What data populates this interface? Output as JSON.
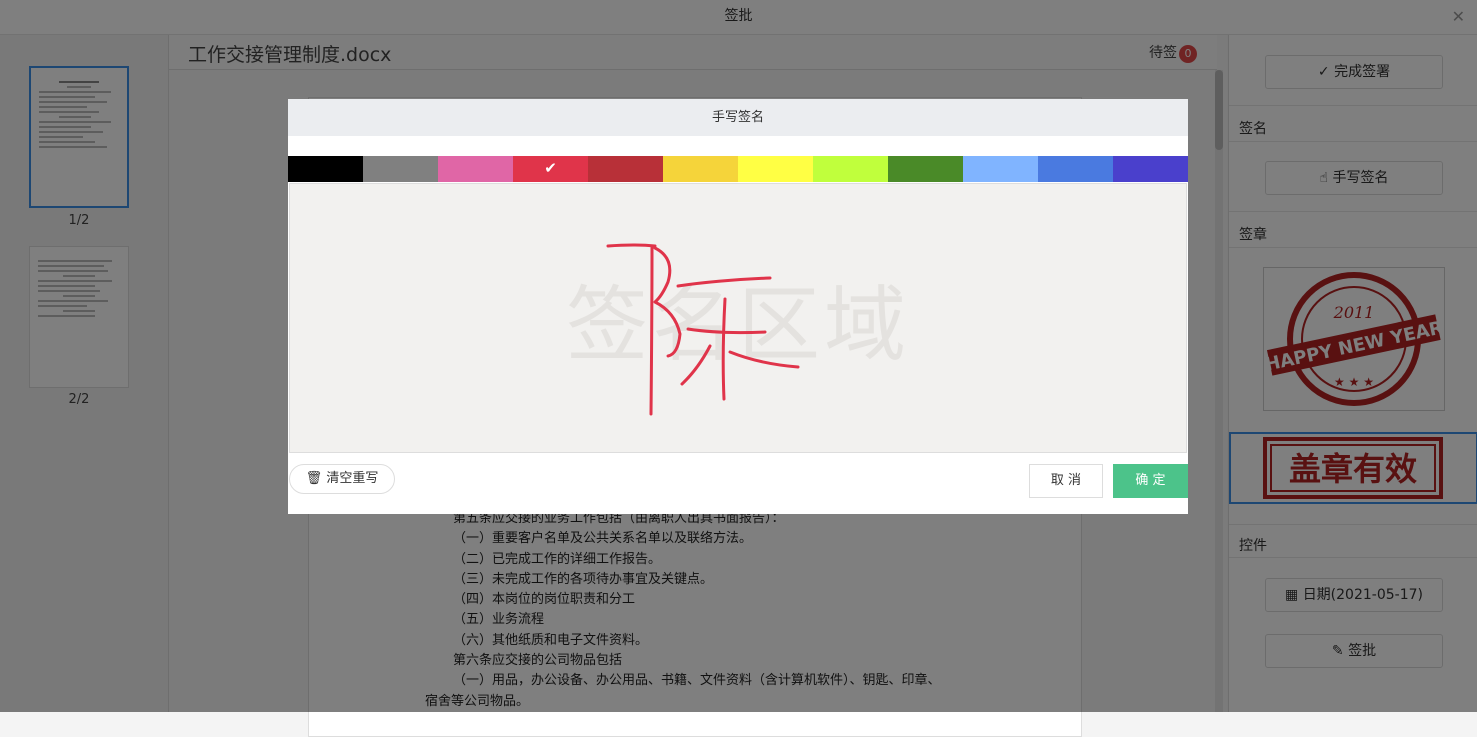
{
  "window": {
    "title": "签批",
    "close_icon": "close-icon"
  },
  "thumbnails": [
    {
      "label": "1/2"
    },
    {
      "label": "2/2"
    }
  ],
  "document": {
    "title": "工作交接管理制度.docx",
    "pending_label": "待签",
    "pending_count": "0",
    "lines": [
      "第五条应交接的业务工作包括（由离职人出具书面报告）：",
      "（一）重要客户名单及公共关系名单以及联络方法。",
      "（二）已完成工作的详细工作报告。",
      "（三）未完成工作的各项待办事宜及关键点。",
      "（四）本岗位的岗位职责和分工",
      "（五）业务流程",
      "（六）其他纸质和电子文件资料。",
      "第六条应交接的公司物品包括",
      "（一）用品，办公设备、办公用品、书籍、文件资料（含计算机软件）、钥匙、印章、",
      "宿舍等公司物品。"
    ]
  },
  "right_panel": {
    "complete_button": "完成签署",
    "signature_section": "签名",
    "handwrite_button": "手写签名",
    "stamp_section": "签章",
    "stamps": [
      {
        "text": "2011 HAPPY NEW YEAR",
        "color": "#b22222"
      },
      {
        "text": "盖章有效",
        "color": "#b22222"
      }
    ],
    "controls_section": "控件",
    "date_button": "日期(2021-05-17)",
    "approve_button": "签批"
  },
  "modal": {
    "title": "手写签名",
    "colors": [
      "#000000",
      "#808080",
      "#e066a6",
      "#e0344a",
      "#b83038",
      "#f5d43a",
      "#ffff44",
      "#c0ff3c",
      "#4a8a28",
      "#80b4ff",
      "#4a7ae0",
      "#4a40cc"
    ],
    "selected_color_index": 3,
    "watermark": "签名区域",
    "signature_text": "陈",
    "clear_button": "清空重写",
    "cancel_button": "取 消",
    "ok_button": "确 定"
  }
}
